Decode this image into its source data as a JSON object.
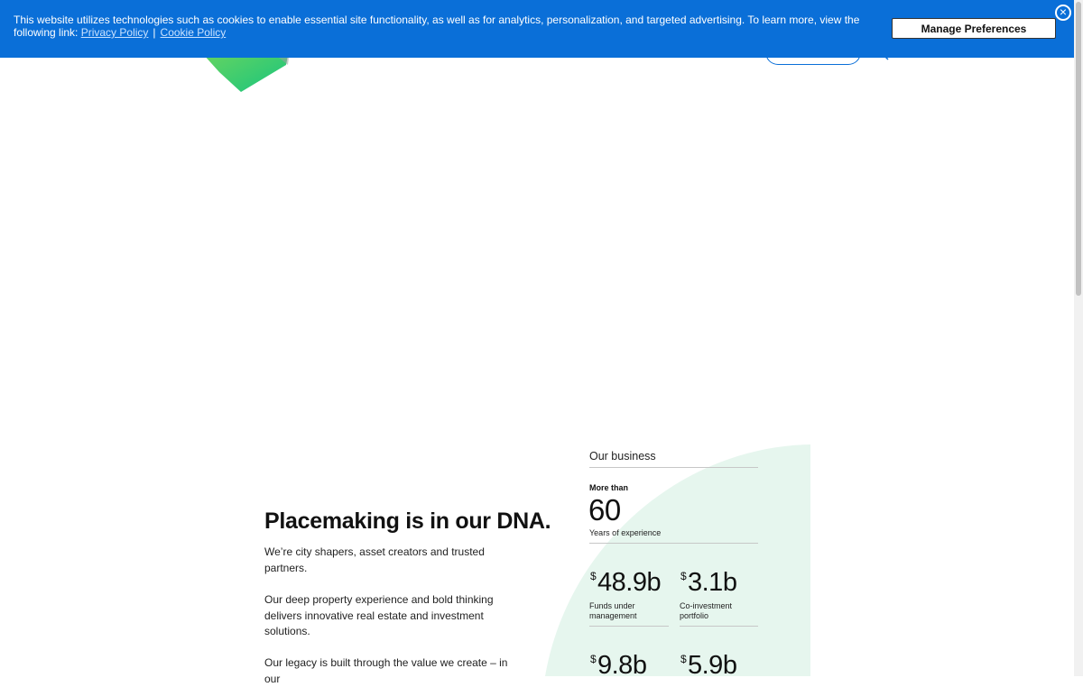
{
  "cookie_banner": {
    "text": "This website utilizes technologies such as cookies to enable essential site functionality, as well as for analytics, personalization, and targeted advertising. To learn more, view the following link:",
    "privacy_link": "Privacy Policy",
    "separator": "|",
    "cookie_link": "Cookie Policy",
    "manage_button": "Manage Preferences",
    "close_symbol": "×"
  },
  "colors": {
    "banner_blue": "#0a6fd8",
    "logo_green": "#22c55e",
    "accent_mint": "#e6f6ee"
  },
  "icons": [
    "close-icon",
    "search-icon",
    "logo"
  ],
  "about": {
    "headline": "Placemaking is in our DNA.",
    "para1": "We’re city shapers, asset creators and trusted partners.",
    "para2": "Our deep property experience and bold thinking delivers innovative real estate and investment solutions.",
    "para3": "Our legacy is built through the value we create – in our"
  },
  "business": {
    "title": "Our business",
    "experience": {
      "prefix": "More than",
      "value": "60",
      "label": "Years of experience"
    },
    "stats": [
      {
        "currency": "$",
        "value": "48.9b",
        "label_line1": "Funds under",
        "label_line2": "management"
      },
      {
        "currency": "$",
        "value": "3.1b",
        "label_line1": "Co-investment",
        "label_line2": "portfolio"
      },
      {
        "currency": "$",
        "value": "9.8b"
      },
      {
        "currency": "$",
        "value": "5.9b"
      }
    ]
  }
}
